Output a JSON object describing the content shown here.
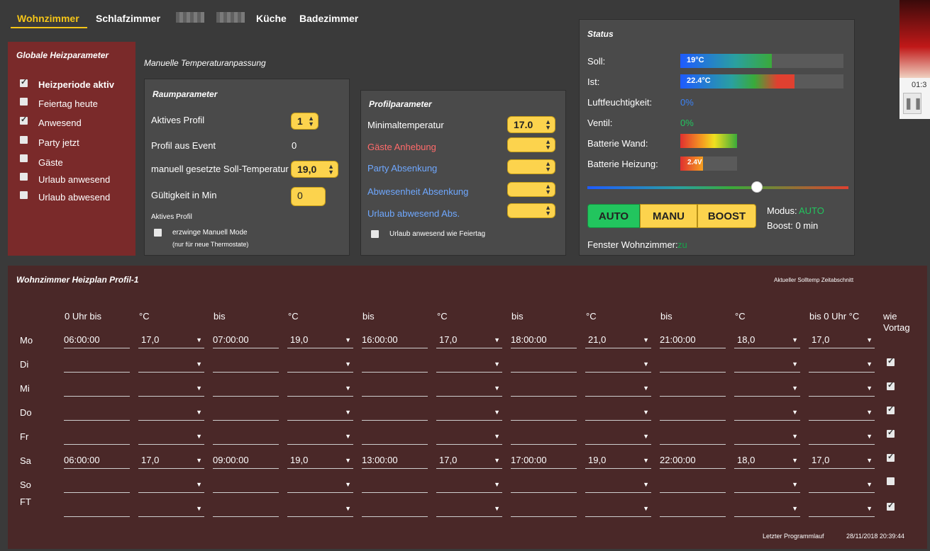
{
  "tabs": [
    {
      "label": "Wohnzimmer",
      "active": true
    },
    {
      "label": "Schlafzimmer",
      "active": false
    },
    {
      "label": "Küche",
      "active": false
    },
    {
      "label": "Badezimmer",
      "active": false
    }
  ],
  "global": {
    "title": "Globale Heizparameter",
    "items": [
      {
        "label": "Heizperiode aktiv",
        "checked": true
      },
      {
        "label": "Feiertag heute",
        "checked": false
      },
      {
        "label": "Anwesend",
        "checked": true
      },
      {
        "label": "Party jetzt",
        "checked": false
      },
      {
        "label": "Gäste",
        "checked": false
      },
      {
        "label": "Urlaub anwesend",
        "checked": false
      },
      {
        "label": "Urlaub abwesend",
        "checked": false
      }
    ]
  },
  "manual_title": "Manuelle Temperaturanpassung",
  "room": {
    "title": "Raumparameter",
    "active_profile_label": "Aktives Profil",
    "active_profile_value": "1",
    "profile_event_label": "Profil aus Event",
    "profile_event_value": "0",
    "manual_temp_label": "manuell gesetzte Soll-Temperatur",
    "manual_temp_value": "19,0",
    "validity_label": "Gültigkeit in Min",
    "validity_value": "0",
    "active_profile_small": "Aktives Profil",
    "force_manual_label": "erzwinge Manuell Mode",
    "force_manual_note": "(nur für neue Thermostate)"
  },
  "profile": {
    "title": "Profilparameter",
    "min_temp_label": "Minimaltemperatur",
    "min_temp_value": "17.0",
    "guests_label": "Gäste Anhebung",
    "party_label": "Party Absenkung",
    "absence_label": "Abwesenheit Absenkung",
    "vacation_label": "Urlaub abwesend Abs.",
    "vacation_holiday_label": "Urlaub anwesend wie Feiertag"
  },
  "status": {
    "title": "Status",
    "soll_label": "Soll:",
    "soll_value": "19°C",
    "soll_fill": 0.56,
    "ist_label": "Ist:",
    "ist_value": "22.4°C",
    "ist_fill": 0.7,
    "humidity_label": "Luftfeuchtigkeit:",
    "humidity_value": "0%",
    "valve_label": "Ventil:",
    "valve_value": "0%",
    "battery_wall_label": "Batterie Wand:",
    "battery_wall_fill": 1.0,
    "battery_heat_label": "Batterie Heizung:",
    "battery_heat_value": "2.4V",
    "battery_heat_fill": 0.4,
    "slider_level": 0.65,
    "buttons": [
      "AUTO",
      "MANU",
      "BOOST"
    ],
    "active_mode": "AUTO",
    "mode_label": "Modus:",
    "mode_value": "AUTO",
    "boost_label": "Boost: 0 min",
    "window_label": "Fenster Wohnzimmer:",
    "window_value": "zu",
    "colors": {
      "green": "#22c55e",
      "blue": "#3b82f6",
      "yellow": "#fcd34d"
    }
  },
  "schedule": {
    "title": "Wohnzimmer Heizplan Profil-1",
    "current_label": "Aktueller Solltemp Zeitabschnitt",
    "headers": [
      "0 Uhr bis",
      "°C",
      "bis",
      "°C",
      "bis",
      "°C",
      "bis",
      "°C",
      "bis",
      "°C",
      "bis 0 Uhr °C",
      "wie",
      "Vortag"
    ],
    "rows": [
      {
        "day": "Mo",
        "cells": [
          "06:00:00",
          "17,0",
          "07:00:00",
          "19,0",
          "16:00:00",
          "17,0",
          "18:00:00",
          "21,0",
          "21:00:00",
          "18,0",
          "17,0"
        ],
        "same_as_prev": null
      },
      {
        "day": "Di",
        "cells": [
          "",
          "",
          "",
          "",
          "",
          "",
          "",
          "",
          "",
          "",
          ""
        ],
        "same_as_prev": true
      },
      {
        "day": "Mi",
        "cells": [
          "",
          "",
          "",
          "",
          "",
          "",
          "",
          "",
          "",
          "",
          ""
        ],
        "same_as_prev": true
      },
      {
        "day": "Do",
        "cells": [
          "",
          "",
          "",
          "",
          "",
          "",
          "",
          "",
          "",
          "",
          ""
        ],
        "same_as_prev": true
      },
      {
        "day": "Fr",
        "cells": [
          "",
          "",
          "",
          "",
          "",
          "",
          "",
          "",
          "",
          "",
          ""
        ],
        "same_as_prev": true
      },
      {
        "day": "Sa",
        "cells": [
          "06:00:00",
          "17,0",
          "09:00:00",
          "19,0",
          "13:00:00",
          "17,0",
          "17:00:00",
          "19,0",
          "22:00:00",
          "18,0",
          "17,0"
        ],
        "same_as_prev": true
      },
      {
        "day": "So",
        "cells": [
          "",
          "",
          "",
          "",
          "",
          "",
          "",
          "",
          "",
          "",
          ""
        ],
        "same_as_prev": false
      },
      {
        "day": "FT",
        "cells": [
          "",
          "",
          "",
          "",
          "",
          "",
          "",
          "",
          "",
          "",
          ""
        ],
        "same_as_prev": true
      }
    ],
    "last_run_label": "Letzter Programmlauf",
    "last_run_value": "28/11/2018 20:39:44"
  },
  "video": {
    "time": "01:3"
  }
}
